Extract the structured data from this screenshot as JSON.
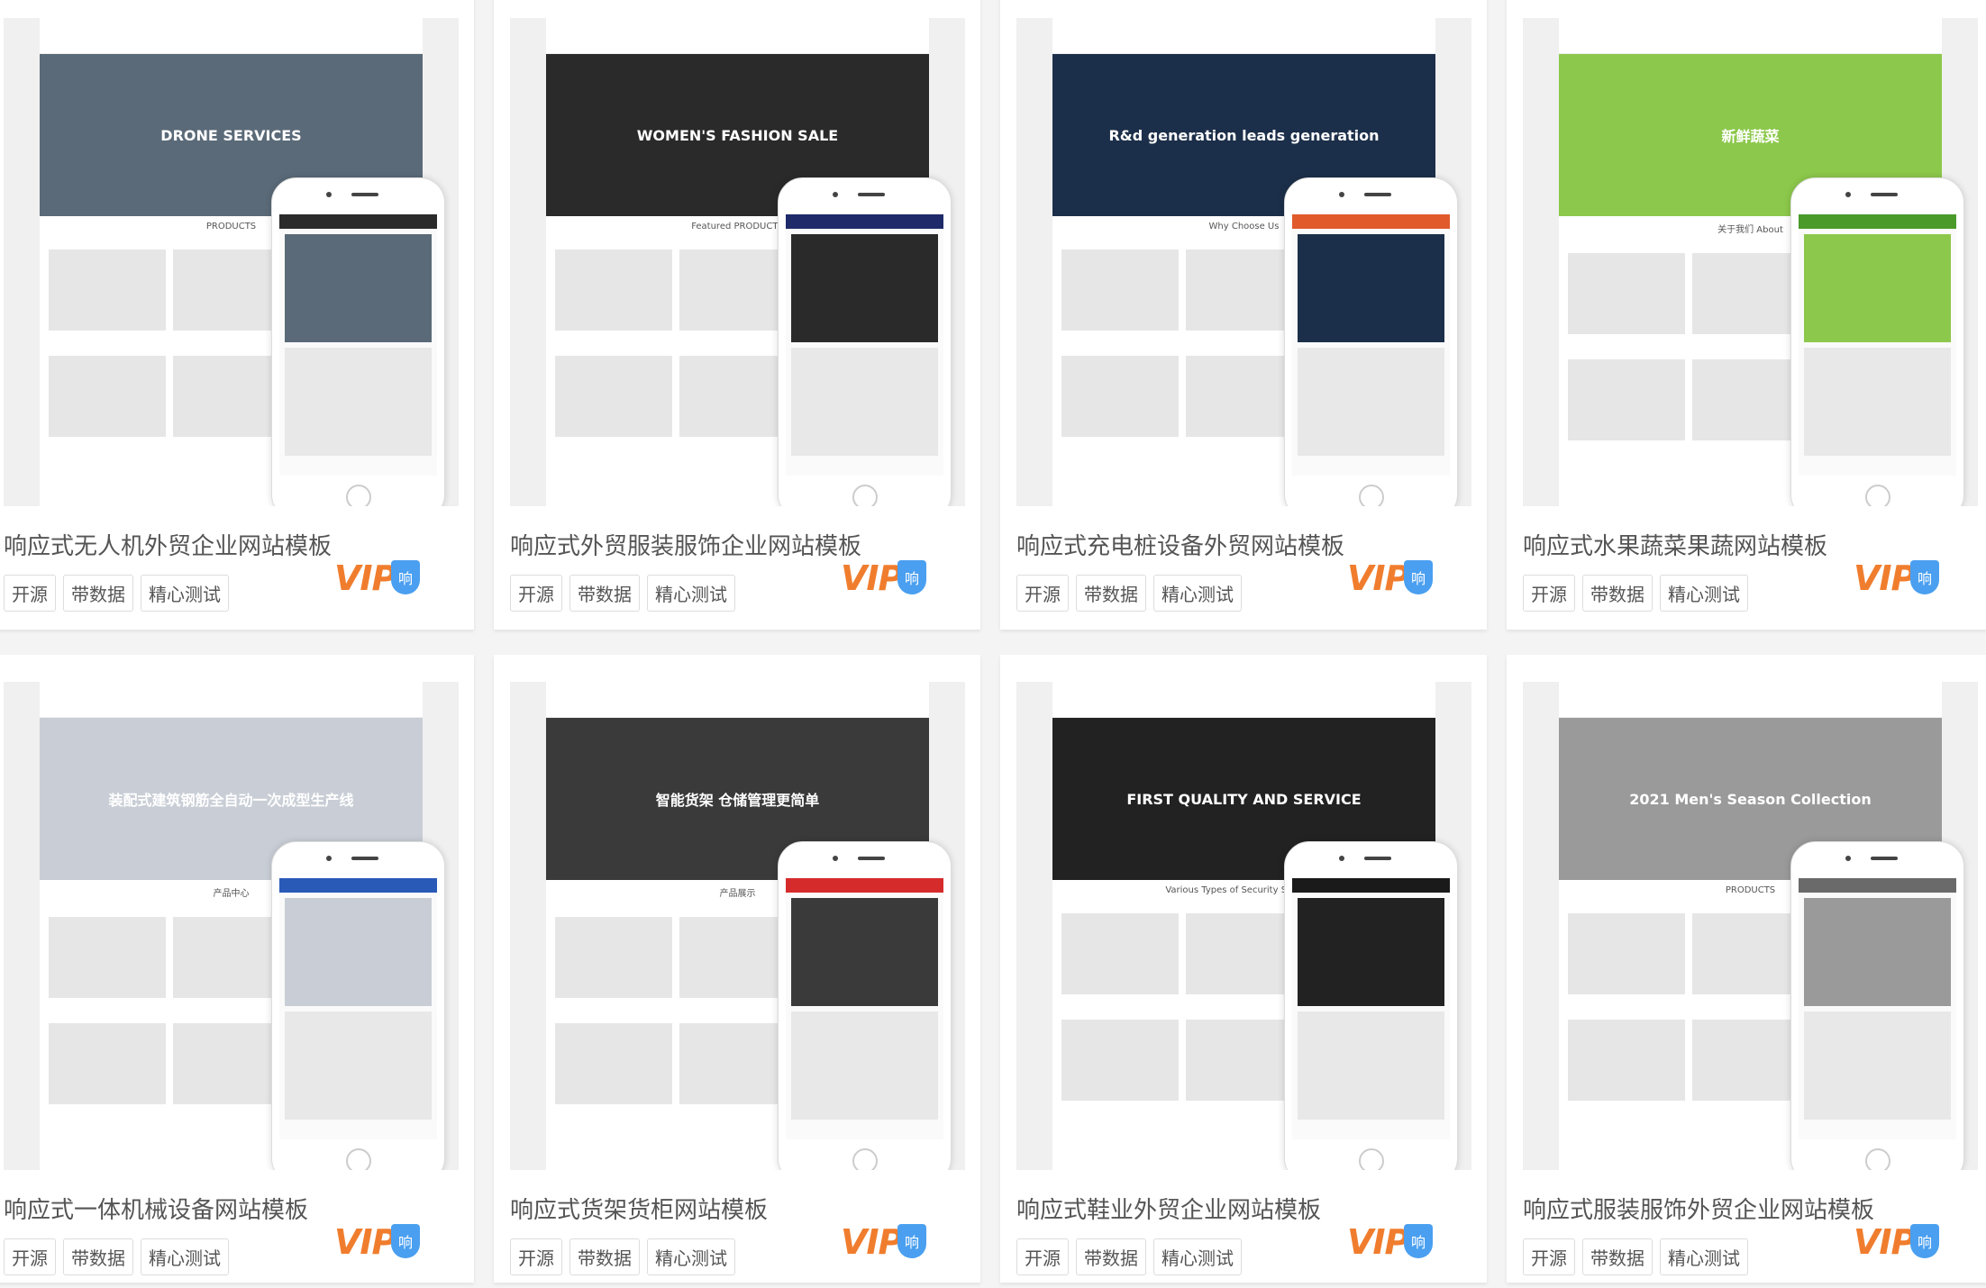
{
  "tags": [
    "开源",
    "带数据",
    "精心测试"
  ],
  "vip_label": "VIP",
  "badge_label": "响",
  "colors": {
    "vip": "#f07d2e",
    "badge": "#4a9ff0",
    "title": "#555555"
  },
  "cards": [
    {
      "title": "响应式无人机外贸企业网站模板",
      "hero_text": "DRONE SERVICES",
      "section": "PRODUCTS",
      "hero_color": "#5a6a78",
      "phone_color": "#2b2b2b"
    },
    {
      "title": "响应式外贸服装服饰企业网站模板",
      "hero_text": "WOMEN'S FASHION SALE",
      "section": "Featured PRODUCTS",
      "hero_color": "#2a2a2a",
      "phone_color": "#1e2a6a"
    },
    {
      "title": "响应式充电桩设备外贸网站模板",
      "hero_text": "R&d generation leads generation",
      "section": "Why Choose Us",
      "hero_color": "#1c2f4a",
      "phone_color": "#e05a2b"
    },
    {
      "title": "响应式水果蔬菜果蔬网站模板",
      "hero_text": "新鲜蔬菜",
      "section": "关于我们 About",
      "hero_color": "#8cc84b",
      "phone_color": "#4a9a2a"
    },
    {
      "title": "响应式一体机械设备网站模板",
      "hero_text": "装配式建筑钢筋全自动一次成型生产线",
      "section": "产品中心",
      "hero_color": "#c9ced6",
      "phone_color": "#2a5ab8"
    },
    {
      "title": "响应式货架货柜网站模板",
      "hero_text": "智能货架 仓储管理更简单",
      "section": "产品展示",
      "hero_color": "#3a3a3a",
      "phone_color": "#d62b2b"
    },
    {
      "title": "响应式鞋业外贸企业网站模板",
      "hero_text": "FIRST QUALITY AND SERVICE",
      "section": "Various Types of Security Solutions",
      "hero_color": "#222222",
      "phone_color": "#1a1a1a"
    },
    {
      "title": "响应式服装服饰外贸企业网站模板",
      "hero_text": "2021 Men's Season Collection",
      "section": "PRODUCTS",
      "hero_color": "#9a9a9a",
      "phone_color": "#6a6a6a"
    }
  ]
}
